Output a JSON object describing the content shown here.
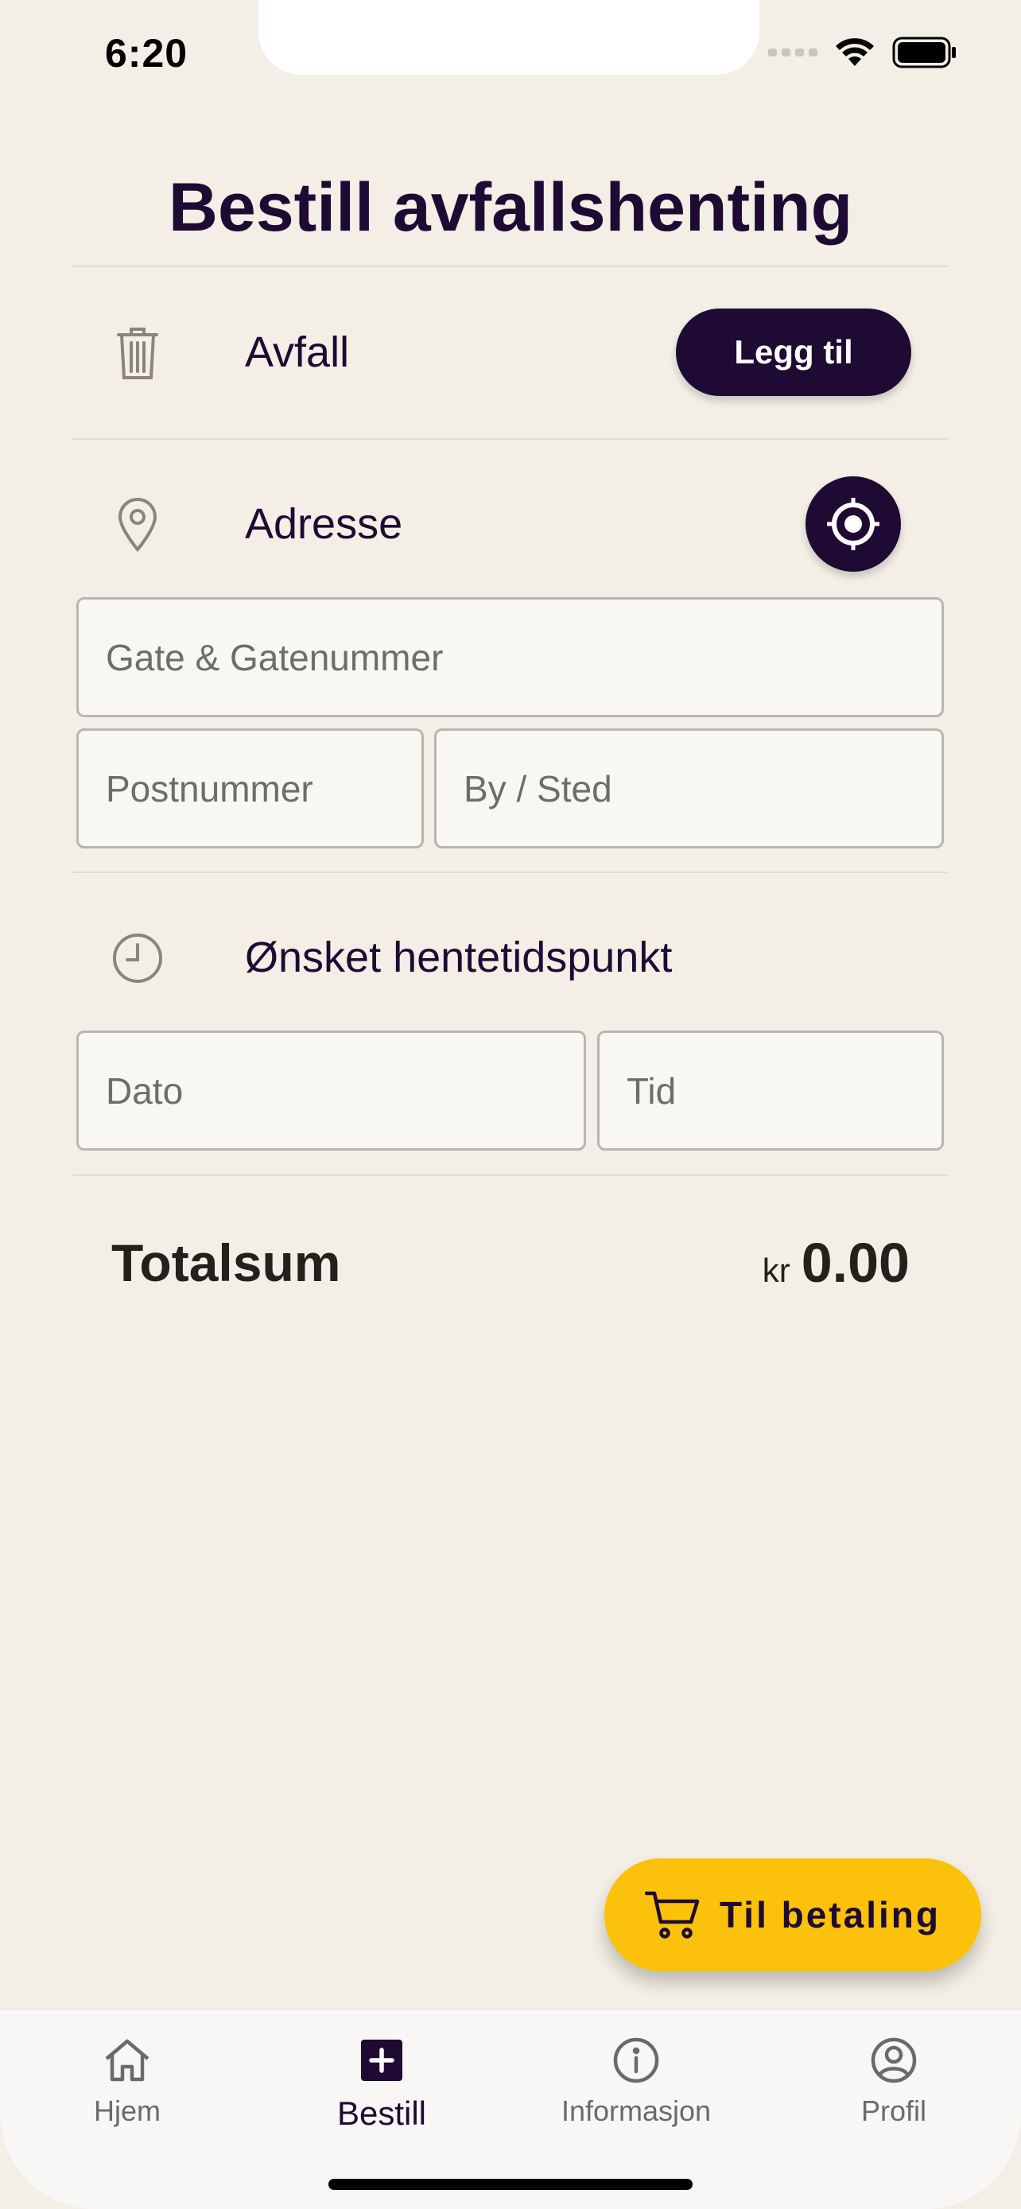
{
  "status_bar": {
    "time": "6:20"
  },
  "header": {
    "title": "Bestill avfallshenting"
  },
  "waste": {
    "label": "Avfall",
    "add_button_label": "Legg til",
    "icon": "trash-icon"
  },
  "address": {
    "label": "Adresse",
    "icon": "location-pin-icon",
    "locate_icon": "crosshair-icon",
    "street_placeholder": "Gate & Gatenummer",
    "postcode_placeholder": "Postnummer",
    "city_placeholder": "By / Sted"
  },
  "pickup": {
    "label": "Ønsket hentetidspunkt",
    "icon": "clock-icon",
    "date_placeholder": "Dato",
    "time_placeholder": "Tid"
  },
  "total": {
    "label": "Totalsum",
    "currency": "kr",
    "amount": "0.00"
  },
  "checkout": {
    "label": "Til betaling",
    "icon": "cart-icon"
  },
  "tabbar": {
    "tabs": [
      {
        "label": "Hjem",
        "icon": "home-icon",
        "active": false
      },
      {
        "label": "Bestill",
        "icon": "plus-square-icon",
        "active": true
      },
      {
        "label": "Informasjon",
        "icon": "info-icon",
        "active": false
      },
      {
        "label": "Profil",
        "icon": "profile-icon",
        "active": false
      }
    ]
  },
  "colors": {
    "background": "#f3efe6",
    "primary": "#1e0a33",
    "accent": "#fcc10a"
  }
}
